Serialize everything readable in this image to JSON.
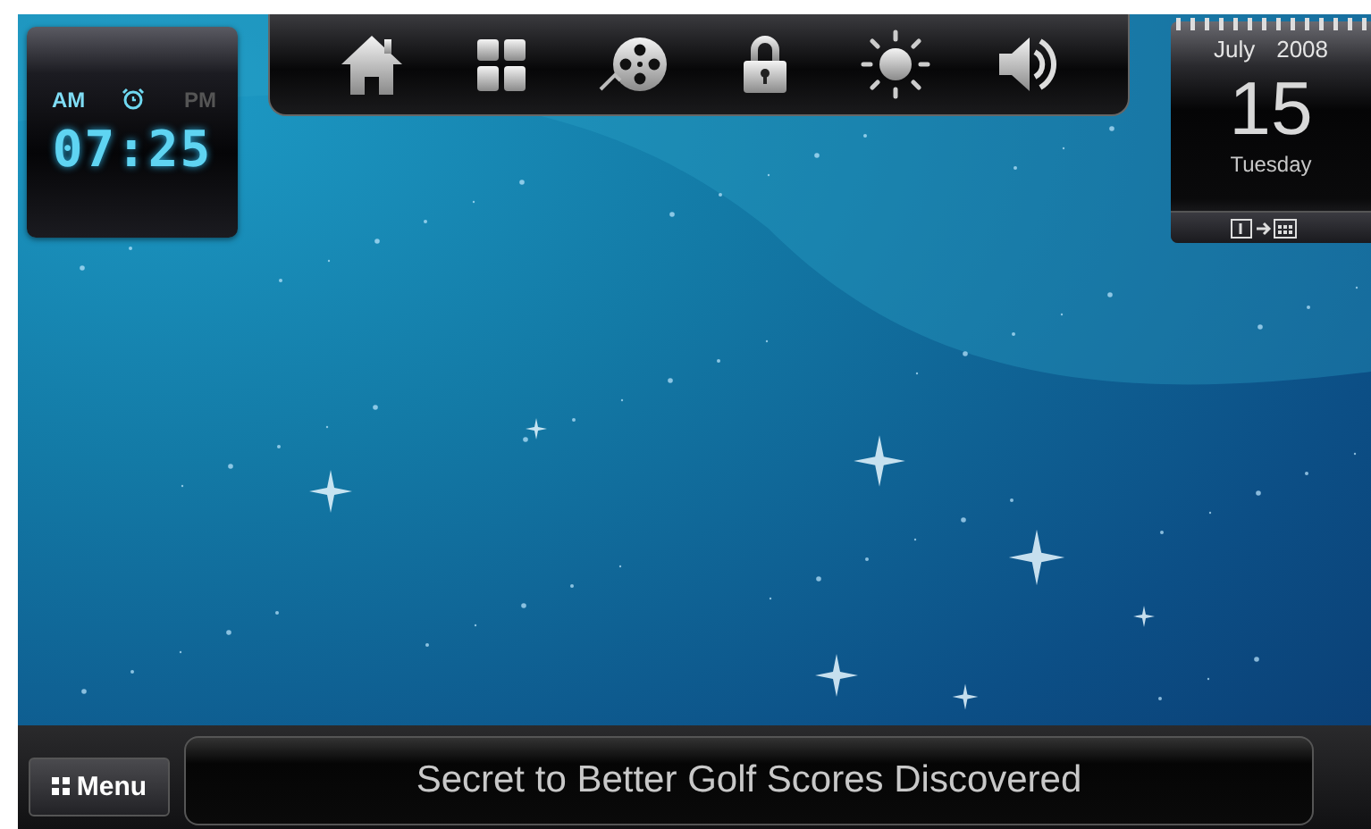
{
  "clock": {
    "periods": [
      {
        "label": "AM",
        "selected": true
      },
      {
        "label": "PM",
        "selected": false
      }
    ],
    "alarm_on": true,
    "time": "07:25"
  },
  "toolbar": [
    {
      "kind": "home"
    },
    {
      "kind": "grid"
    },
    {
      "kind": "film"
    },
    {
      "kind": "lock"
    },
    {
      "kind": "sun"
    },
    {
      "kind": "speaker"
    }
  ],
  "calendar": {
    "month": "July",
    "year": "2008",
    "day": "15",
    "weekday": "Tuesday"
  },
  "menu_button": {
    "label": "Menu"
  },
  "ticker": "Secret to Better Golf Scores Discovered"
}
